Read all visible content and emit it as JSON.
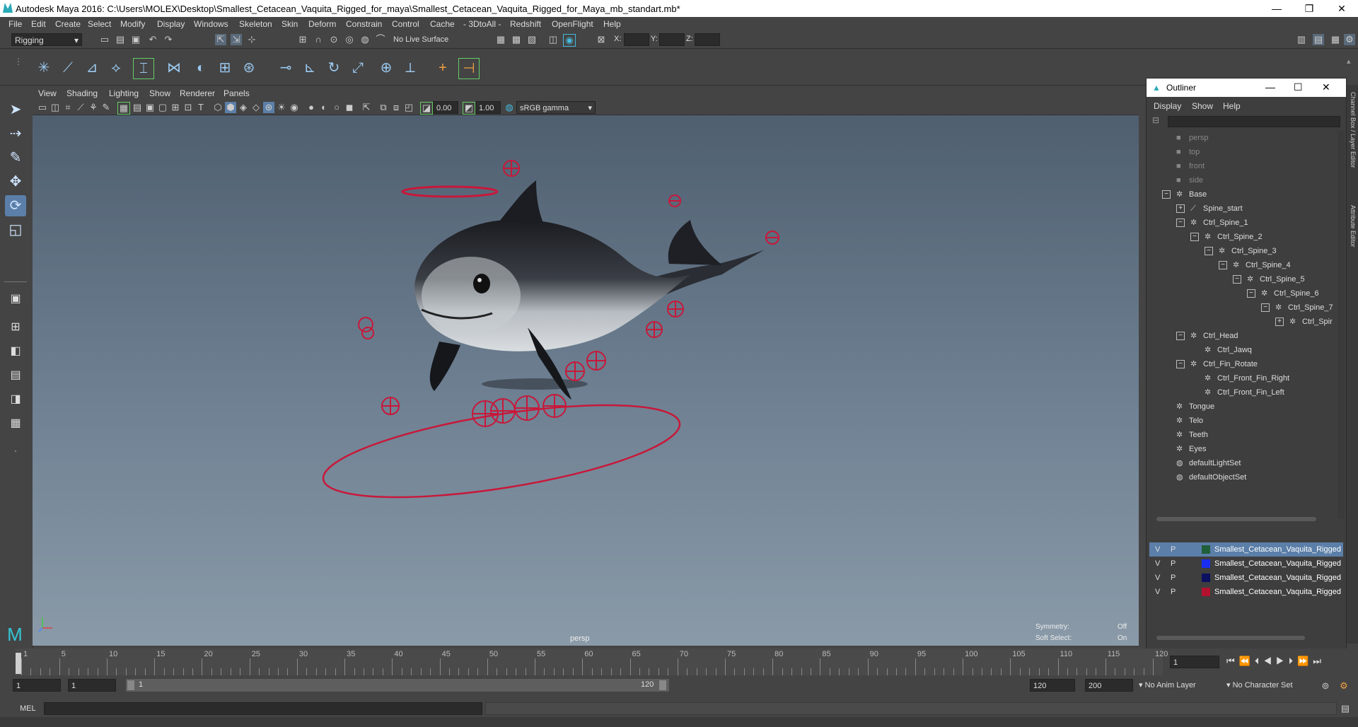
{
  "window": {
    "title": "Autodesk Maya 2016: C:\\Users\\MOLEX\\Desktop\\Smallest_Cetacean_Vaquita_Rigged_for_maya\\Smallest_Cetacean_Vaquita_Rigged_for_Maya_mb_standart.mb*",
    "minimize": "—",
    "restore": "❐",
    "close": "✕"
  },
  "menubar": [
    "File",
    "Edit",
    "Create",
    "Select",
    "Modify",
    "Display",
    "Windows",
    "Skeleton",
    "Skin",
    "Deform",
    "Constrain",
    "Control",
    "Cache",
    "- 3DtoAll -",
    "Redshift",
    "OpenFlight",
    "Help"
  ],
  "statusline": {
    "mode": "Rigging",
    "live_surface": "No Live Surface",
    "x_label": "X:",
    "y_label": "Y:",
    "z_label": "Z:"
  },
  "viewport": {
    "menus": [
      "View",
      "Shading",
      "Lighting",
      "Show",
      "Renderer",
      "Panels"
    ],
    "field_a": "0.00",
    "field_b": "1.00",
    "color_space": "sRGB gamma",
    "camera_label": "persp",
    "symmetry_label": "Symmetry:",
    "symmetry_value": "Off",
    "soft_select_label": "Soft Select:",
    "soft_select_value": "On"
  },
  "outliner": {
    "title": "Outliner",
    "menus": [
      "Display",
      "Show",
      "Help"
    ],
    "items": [
      {
        "label": "persp",
        "depth": 0,
        "kind": "camera",
        "expander": ""
      },
      {
        "label": "top",
        "depth": 0,
        "kind": "camera",
        "expander": ""
      },
      {
        "label": "front",
        "depth": 0,
        "kind": "camera",
        "expander": ""
      },
      {
        "label": "side",
        "depth": 0,
        "kind": "camera",
        "expander": ""
      },
      {
        "label": "Base",
        "depth": 0,
        "kind": "transform",
        "expander": "−"
      },
      {
        "label": "Spine_start",
        "depth": 1,
        "kind": "joint",
        "expander": "+"
      },
      {
        "label": "Ctrl_Spine_1",
        "depth": 1,
        "kind": "transform",
        "expander": "−"
      },
      {
        "label": "Ctrl_Spine_2",
        "depth": 2,
        "kind": "transform",
        "expander": "−"
      },
      {
        "label": "Ctrl_Spine_3",
        "depth": 3,
        "kind": "transform",
        "expander": "−"
      },
      {
        "label": "Ctrl_Spine_4",
        "depth": 4,
        "kind": "transform",
        "expander": "−"
      },
      {
        "label": "Ctrl_Spine_5",
        "depth": 5,
        "kind": "transform",
        "expander": "−"
      },
      {
        "label": "Ctrl_Spine_6",
        "depth": 6,
        "kind": "transform",
        "expander": "−"
      },
      {
        "label": "Ctrl_Spine_7",
        "depth": 7,
        "kind": "transform",
        "expander": "−"
      },
      {
        "label": "Ctrl_Spir",
        "depth": 8,
        "kind": "transform",
        "expander": "+"
      },
      {
        "label": "Ctrl_Head",
        "depth": 1,
        "kind": "transform",
        "expander": "−"
      },
      {
        "label": "Ctrl_Jawq",
        "depth": 2,
        "kind": "transform",
        "expander": ""
      },
      {
        "label": "Ctrl_Fin_Rotate",
        "depth": 1,
        "kind": "transform",
        "expander": "−"
      },
      {
        "label": "Ctrl_Front_Fin_Right",
        "depth": 2,
        "kind": "transform",
        "expander": ""
      },
      {
        "label": "Ctrl_Front_Fin_Left",
        "depth": 2,
        "kind": "transform",
        "expander": ""
      },
      {
        "label": "Tongue",
        "depth": 0,
        "kind": "transform",
        "expander": ""
      },
      {
        "label": "Telo",
        "depth": 0,
        "kind": "transform",
        "expander": ""
      },
      {
        "label": "Teeth",
        "depth": 0,
        "kind": "transform",
        "expander": ""
      },
      {
        "label": "Eyes",
        "depth": 0,
        "kind": "transform",
        "expander": ""
      },
      {
        "label": "defaultLightSet",
        "depth": 0,
        "kind": "set",
        "expander": ""
      },
      {
        "label": "defaultObjectSet",
        "depth": 0,
        "kind": "set",
        "expander": ""
      }
    ],
    "layers": [
      {
        "v": "V",
        "p": "P",
        "name": "Smallest_Cetacean_Vaquita_Rigged",
        "color": "#1f5f3a",
        "selected": true
      },
      {
        "v": "V",
        "p": "P",
        "name": "Smallest_Cetacean_Vaquita_Rigged",
        "color": "#1a2ef0",
        "selected": false
      },
      {
        "v": "V",
        "p": "P",
        "name": "Smallest_Cetacean_Vaquita_Rigged",
        "color": "#0b1160",
        "selected": false
      },
      {
        "v": "V",
        "p": "P",
        "name": "Smallest_Cetacean_Vaquita_Rigged",
        "color": "#b3122e",
        "selected": false
      }
    ]
  },
  "timeline": {
    "ticks": [
      "1",
      "5",
      "10",
      "15",
      "20",
      "25",
      "30",
      "35",
      "40",
      "45",
      "50",
      "55",
      "60",
      "65",
      "70",
      "75",
      "80",
      "85",
      "90",
      "95",
      "100",
      "105",
      "110",
      "115",
      "120"
    ],
    "current_frame": "1"
  },
  "range": {
    "start": "1",
    "playback_start": "1",
    "slider_start": "1",
    "slider_end": "120",
    "playback_end": "120",
    "end": "200",
    "anim_layer": "No Anim Layer",
    "character_set": "No Character Set"
  },
  "command": {
    "label": "MEL"
  },
  "colors": {
    "control_red": "#c8183a",
    "accent": "#5b9bd5"
  }
}
